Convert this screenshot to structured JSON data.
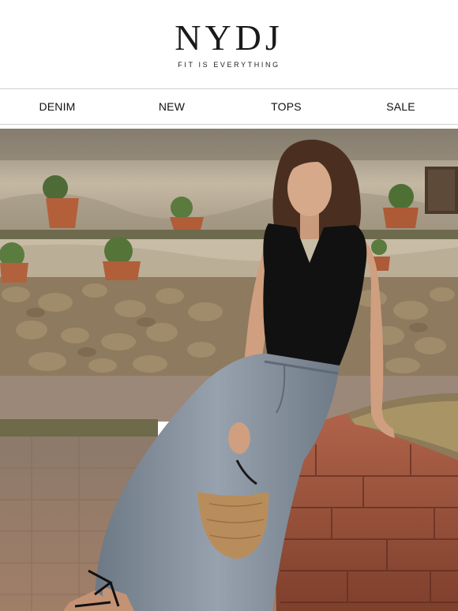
{
  "brand": {
    "logo_text": "NYDJ",
    "tagline": "FIT IS EVERYTHING"
  },
  "nav": {
    "items": [
      {
        "label": "DENIM"
      },
      {
        "label": "NEW"
      },
      {
        "label": "TOPS"
      },
      {
        "label": "SALE"
      }
    ]
  },
  "hero": {
    "image_subject": "woman-denim-maxi-skirt-black-top-courtyard",
    "colors": {
      "top": "#111111",
      "skirt": "#7f8a97",
      "wall": "#b9aa94",
      "brick": "#a2543c",
      "basket": "#b98d5b"
    }
  }
}
